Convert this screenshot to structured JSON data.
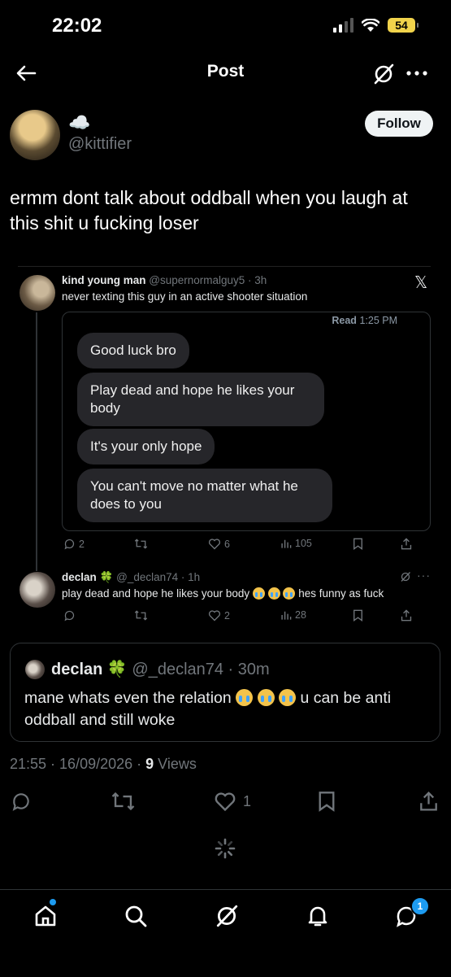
{
  "status_bar": {
    "time": "22:02",
    "battery": "54"
  },
  "header": {
    "title": "Post"
  },
  "author": {
    "display_name": "☁️",
    "handle": "@kittifier",
    "follow_label": "Follow"
  },
  "post": {
    "text": "ermm dont talk about oddball when you laugh at this shit u fucking loser",
    "timestamp": "21:55 · 16/09/2026 · ",
    "views_count": "9",
    "views_label": " Views",
    "likes": "1"
  },
  "embedded": {
    "tweet": {
      "name": "kind young man",
      "handle": "@supernormalguy5 · 3h",
      "text": "never texting this guy in an active shooter situation",
      "read_label": "Read",
      "read_time": "1:25 PM",
      "messages": [
        "Good luck bro",
        "Play dead and hope he likes your body",
        "It's your only hope",
        "You can't move no matter what he does to you"
      ],
      "replies": "2",
      "likes": "6",
      "views": "105"
    },
    "reply": {
      "name": "declan",
      "clover": "🍀",
      "handle": "@_declan74 · 1h",
      "text_a": "play dead and hope he likes your body",
      "text_b": "hes funny as fuck",
      "likes": "2",
      "views": "28"
    }
  },
  "quoted": {
    "name": "declan",
    "clover": "🍀",
    "handle": "@_declan74 · 30m",
    "text_a": "mane whats even the relation",
    "text_b": "u can be anti oddball and still woke"
  },
  "nav": {
    "messages_badge": "1"
  },
  "colors": {
    "accent": "#1d9bf0",
    "background": "#000000",
    "muted": "#71767b",
    "bubble": "#26262a"
  }
}
